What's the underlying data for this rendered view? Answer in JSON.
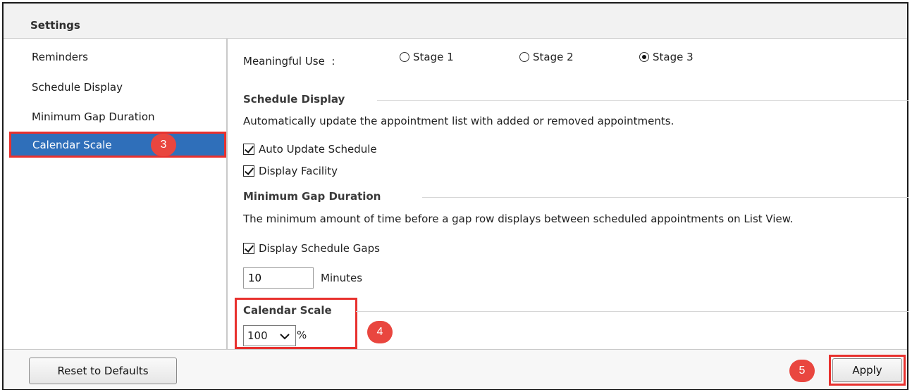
{
  "header": {
    "title": "Settings"
  },
  "sidebar": {
    "items": [
      {
        "label": "Reminders"
      },
      {
        "label": "Schedule Display"
      },
      {
        "label": "Minimum Gap Duration"
      },
      {
        "label": "Calendar Scale",
        "selected": true,
        "badge": "3"
      }
    ]
  },
  "meaningful_use": {
    "label": "Meaningful Use",
    "separator": ":",
    "options": [
      "Stage 1",
      "Stage 2",
      "Stage 3"
    ],
    "selected": "Stage 3"
  },
  "schedule_display": {
    "heading": "Schedule Display",
    "description": "Automatically update the appointment list with added or removed appointments.",
    "auto_update_label": "Auto Update Schedule",
    "auto_update_checked": true,
    "display_facility_label": "Display Facility",
    "display_facility_checked": true
  },
  "min_gap": {
    "heading": "Minimum Gap Duration",
    "description": "The minimum amount of time before a gap row displays between scheduled appointments on List View.",
    "display_gaps_label": "Display Schedule Gaps",
    "display_gaps_checked": true,
    "value": "10",
    "unit": "Minutes"
  },
  "calendar_scale": {
    "heading": "Calendar Scale",
    "value": "100",
    "unit": "%",
    "badge": "4"
  },
  "footer": {
    "reset_label": "Reset to Defaults",
    "apply_label": "Apply",
    "apply_badge": "5"
  },
  "colors": {
    "selection": "#2f6fba",
    "highlight": "#e8312e",
    "badge": "#e9463f"
  }
}
